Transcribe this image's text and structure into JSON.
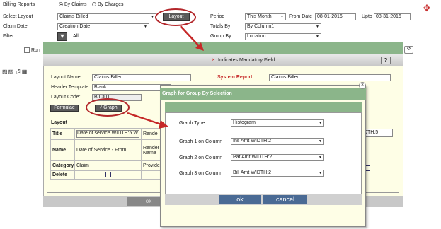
{
  "filters": {
    "billing_reports_label": "Billing Reports",
    "radio_by_claims": "By Claims",
    "radio_by_charges": "By Charges",
    "select_layout_label": "Select Layout",
    "select_layout_value": "Claims Billed",
    "layout_button": "Layout",
    "period_label": "Period",
    "period_value": "This Month",
    "from_date_label": "From Date",
    "from_date_value": "08-01-2016",
    "upto_label": "Upto",
    "upto_value": "08-31-2016",
    "claim_date_label": "Claim Date",
    "claim_date_value": "Creation Date",
    "totals_by_label": "Totals By",
    "totals_by_value": "By Column1",
    "filter_label": "Filter",
    "filter_value": "All",
    "group_by_label": "Group By",
    "group_by_value": "Location",
    "run_label": "Run"
  },
  "layout_dialog": {
    "mandatory_note": "Indicates Mandatory Field",
    "mandatory_mark": "×",
    "help_button": "?",
    "layout_name_label": "Layout Name:",
    "layout_name_value": "Claims Billed",
    "system_report_label": "System Report:",
    "system_report_value": "Claims Billed",
    "header_template_label": "Header Template:",
    "header_template_value": "Blank",
    "layout_code_label": "Layout Code:",
    "layout_code_value": "BIL301",
    "formulae_button": "Formulae",
    "graph_button": "√ Graph",
    "layout_section_label": "Layout",
    "grid_rows": [
      {
        "head": "Title",
        "c1": "Date of service WIDTH:5 W",
        "c2": "Rende"
      },
      {
        "head": "Name",
        "c1": "Date of Service - From",
        "c2": "Render Name"
      },
      {
        "head": "Category",
        "c1": "Claim",
        "c2": "Provide"
      },
      {
        "head": "Delete",
        "c1": "",
        "c2": ""
      }
    ],
    "right_cell": "IDTH:5",
    "ok_button": "ok"
  },
  "graph_dialog": {
    "title": "Graph for Group By Selection",
    "graph_type_label": "Graph Type",
    "graph_type_value": "Histogram",
    "col1_label": "Graph 1 on Column",
    "col1_value": "Ins Amt WIDTH:2",
    "col2_label": "Graph 2 on Column",
    "col2_value": "Pat Amt WIDTH:2",
    "col3_label": "Graph 3 on Column",
    "col3_value": "Bill Amt WIDTH:2",
    "ok_button": "ok",
    "cancel_button": "cancel"
  },
  "colors": {
    "accent_red": "#b3262a",
    "header_green": "#8bb58a",
    "button_blue": "#4a6a94",
    "panel_cream": "#fefee6"
  }
}
